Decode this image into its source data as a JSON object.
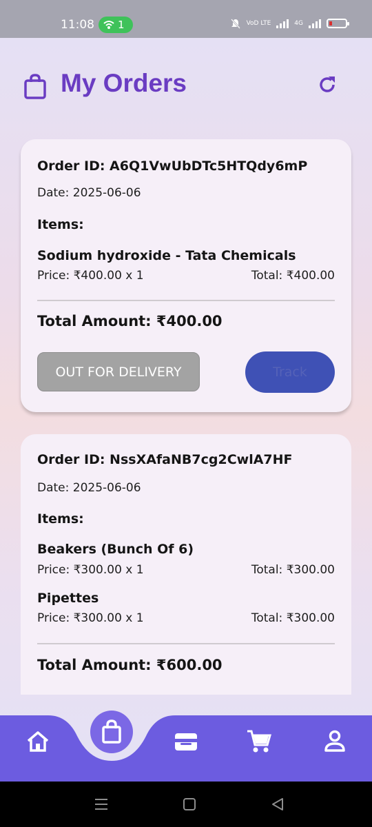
{
  "status_bar": {
    "time": "11:08",
    "hotspot_count": "1",
    "network_label_1": "VoD LTE",
    "network_label_2": "4G"
  },
  "header": {
    "title": "My Orders",
    "icon": "shopping-bag-icon",
    "refresh_icon": "refresh-icon"
  },
  "orders": [
    {
      "order_id": "Order ID: A6Q1VwUbDTc5HTQdy6mP",
      "date": "Date: 2025-06-06",
      "items_heading": "Items:",
      "items": [
        {
          "name": "Sodium hydroxide - Tata Chemicals",
          "price": "Price: ₹400.00 x 1",
          "total": "Total: ₹400.00"
        }
      ],
      "total_amount": "Total Amount: ₹400.00",
      "status": "OUT FOR DELIVERY",
      "track_label": "Track"
    },
    {
      "order_id": "Order ID: NssXAfaNB7cg2CwlA7HF",
      "date": "Date: 2025-06-06",
      "items_heading": "Items:",
      "items": [
        {
          "name": "Beakers (Bunch Of 6)",
          "price": "Price: ₹300.00 x 1",
          "total": "Total: ₹300.00"
        },
        {
          "name": "Pipettes",
          "price": "Price: ₹300.00 x 1",
          "total": "Total: ₹300.00"
        }
      ],
      "total_amount": "Total Amount: ₹600.00"
    }
  ],
  "bottom_nav": {
    "items": [
      "home-icon",
      "shopping-bag-icon",
      "wallet-icon",
      "cart-icon",
      "profile-icon"
    ],
    "active": "shopping-bag-icon"
  },
  "colors": {
    "accent": "#6a3cc2",
    "nav_bar": "#6c5ce0",
    "track_button": "#3f51b5",
    "status_chip": "#a3a3a3",
    "card_bg": "#f6eff8"
  }
}
